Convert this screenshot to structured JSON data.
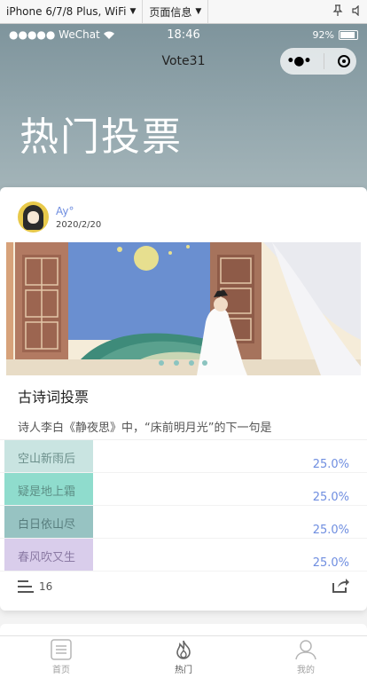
{
  "devtools": {
    "device": "iPhone 6/7/8 Plus, WiFi",
    "page_info": "页面信息",
    "pin_icon": "pin-icon",
    "mute_icon": "speaker-icon"
  },
  "status_bar": {
    "carrier": "●●●●● WeChat",
    "time": "18:46",
    "battery": "92%"
  },
  "nav": {
    "title": "Vote31"
  },
  "page": {
    "heading": "热门投票"
  },
  "poll": {
    "author": "Ay°",
    "date": "2020/2/20",
    "title": "古诗词投票",
    "description": "诗人李白《静夜思》中，“床前明月光”的下一句是",
    "options": [
      {
        "label": "空山新雨后",
        "percent": "25.0%",
        "fraction": 0.25
      },
      {
        "label": "疑是地上霜",
        "percent": "25.0%",
        "fraction": 0.25
      },
      {
        "label": "白日依山尽",
        "percent": "25.0%",
        "fraction": 0.25
      },
      {
        "label": "春风吹又生",
        "percent": "25.0%",
        "fraction": 0.25
      }
    ],
    "vote_count": "16"
  },
  "tabbar": {
    "items": [
      {
        "label": "首页",
        "icon": "home-icon"
      },
      {
        "label": "热门",
        "icon": "flame-icon"
      },
      {
        "label": "我的",
        "icon": "user-icon"
      }
    ]
  }
}
